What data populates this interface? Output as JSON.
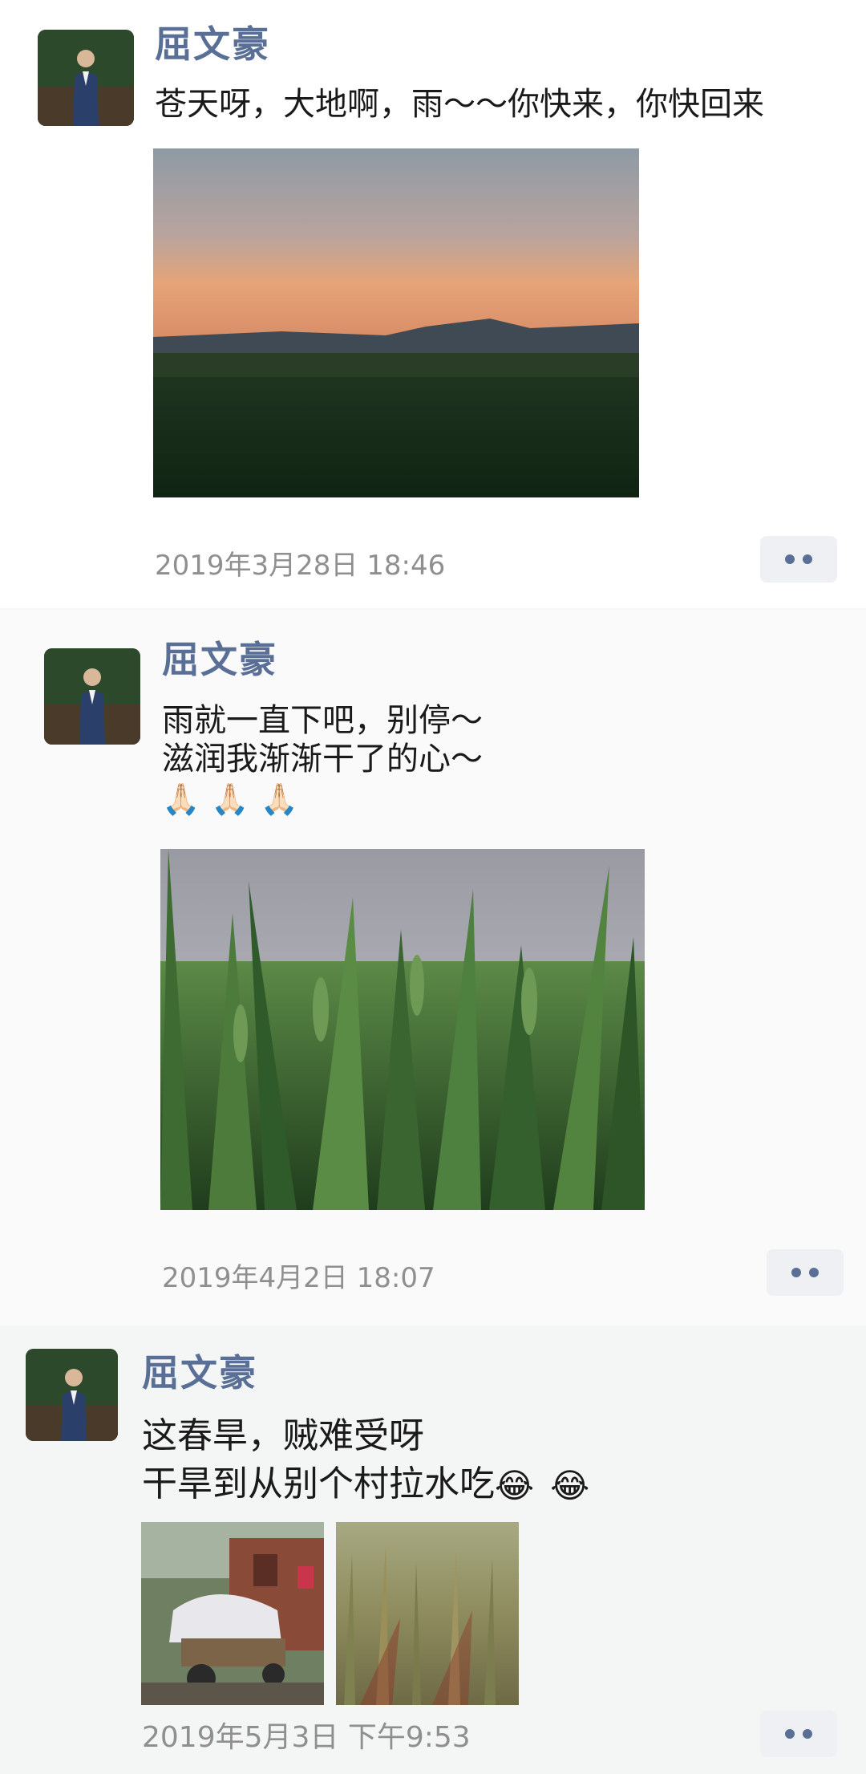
{
  "posts": [
    {
      "author": "屈文豪",
      "lines": [
        "苍天呀，大地啊，雨～～你快来，你快回来"
      ],
      "timestamp": "2019年3月28日 18:46",
      "photos": [
        "sunset-field-photo"
      ]
    },
    {
      "author": "屈文豪",
      "lines": [
        "雨就一直下吧，别停～",
        "滋润我渐渐干了的心～"
      ],
      "emojis": [
        "🙏🏻",
        "🙏🏻",
        "🙏🏻"
      ],
      "timestamp": "2019年4月2日 18:07",
      "photos": [
        "wheat-closeup-photo"
      ]
    },
    {
      "author": "屈文豪",
      "lines": [
        "这春旱，贼难受呀",
        "干旱到从别个村拉水吃"
      ],
      "line2_emojis": [
        "😂",
        "😂"
      ],
      "timestamp": "2019年5月3日 下午9:53",
      "photos": [
        "water-tractor-photo",
        "dry-wheat-photo"
      ]
    }
  ],
  "icons": {
    "more": "more-dots-icon",
    "emoji_pray": "folded-hands-emoji",
    "emoji_laugh": "tears-of-joy-emoji"
  },
  "colors": {
    "name": "#5a6f96",
    "timestamp": "#8f8f8f",
    "text": "#1a1a1a"
  }
}
